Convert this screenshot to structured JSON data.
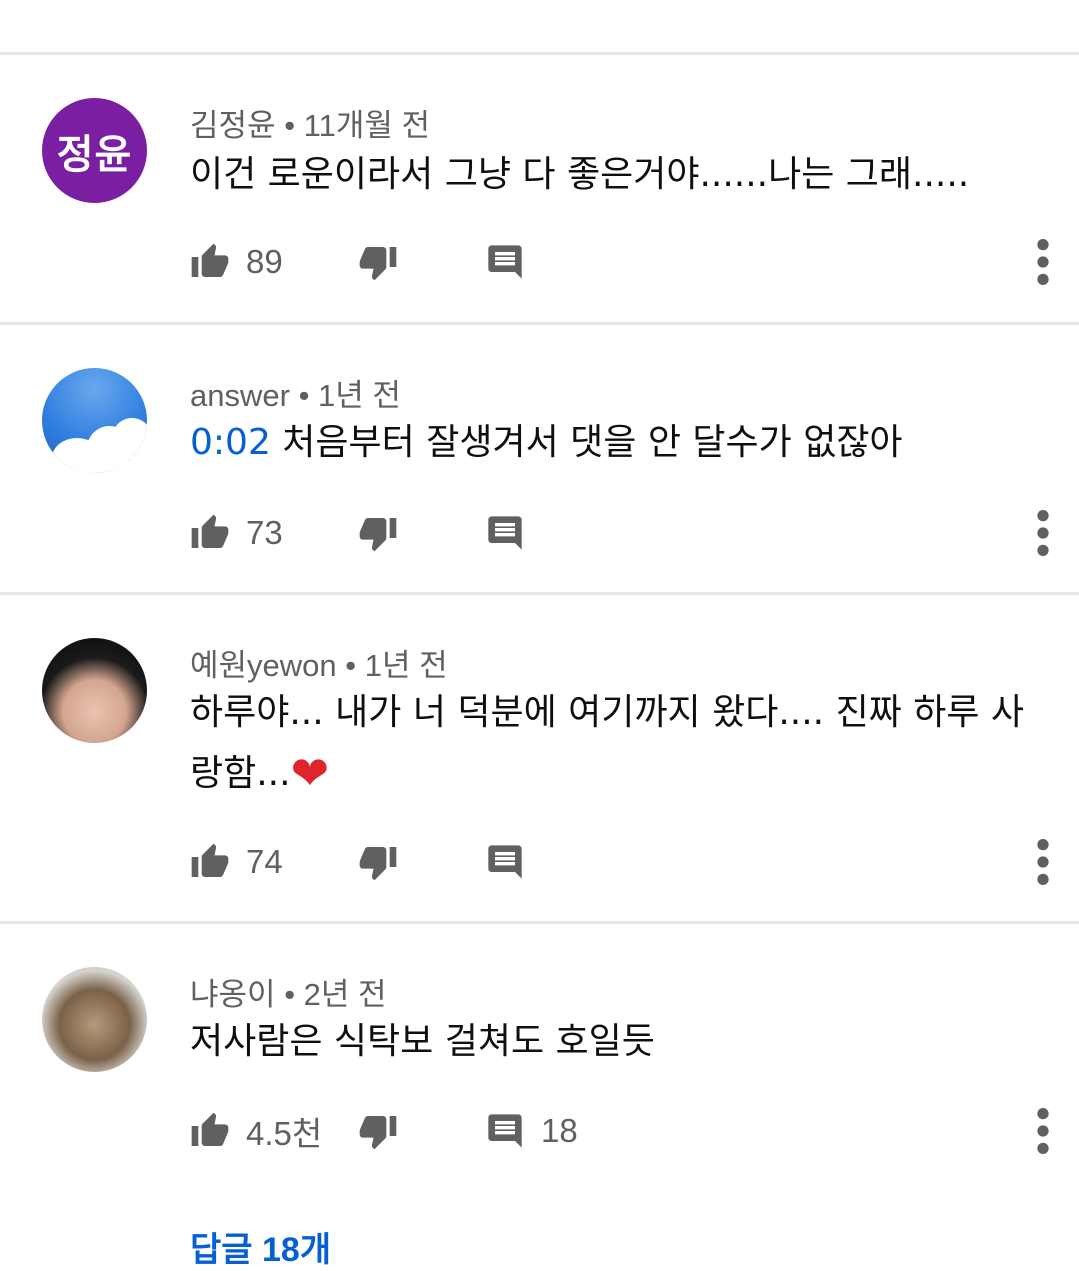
{
  "colors": {
    "link": "#065fd4",
    "meta": "#606060",
    "avatar_purple": "#7b1fa2",
    "divider": "#e6e6e6"
  },
  "comments": [
    {
      "avatar_initials": "정윤",
      "author": "김정윤",
      "time": "11개월 전",
      "text": "이건 로운이라서 그냥 다 좋은거야......나는 그래.....",
      "likes": "89",
      "replies": ""
    },
    {
      "avatar_initials": "",
      "author": "answer",
      "time": "1년 전",
      "timestamp_link": "0:02",
      "text": "처음부터 잘생겨서 댓을 안 달수가 없잖아",
      "likes": "73",
      "replies": ""
    },
    {
      "avatar_initials": "",
      "author": "예원yewon",
      "time": "1년 전",
      "text": "하루야... 내가 너 덕분에 여기까지 왔다.... 진짜 하루 사랑함...",
      "emoji": "❤",
      "likes": "74",
      "replies": ""
    },
    {
      "avatar_initials": "",
      "author": "냐옹이",
      "time": "2년 전",
      "text": "저사람은 식탁보 걸쳐도 호일듯",
      "likes": "4.5천",
      "replies": "18"
    }
  ],
  "replies_link": "답글 18개",
  "separator": "•",
  "icons": {
    "like": "thumb-up-icon",
    "dislike": "thumb-down-icon",
    "reply": "comment-icon",
    "more": "more-vert-icon"
  }
}
